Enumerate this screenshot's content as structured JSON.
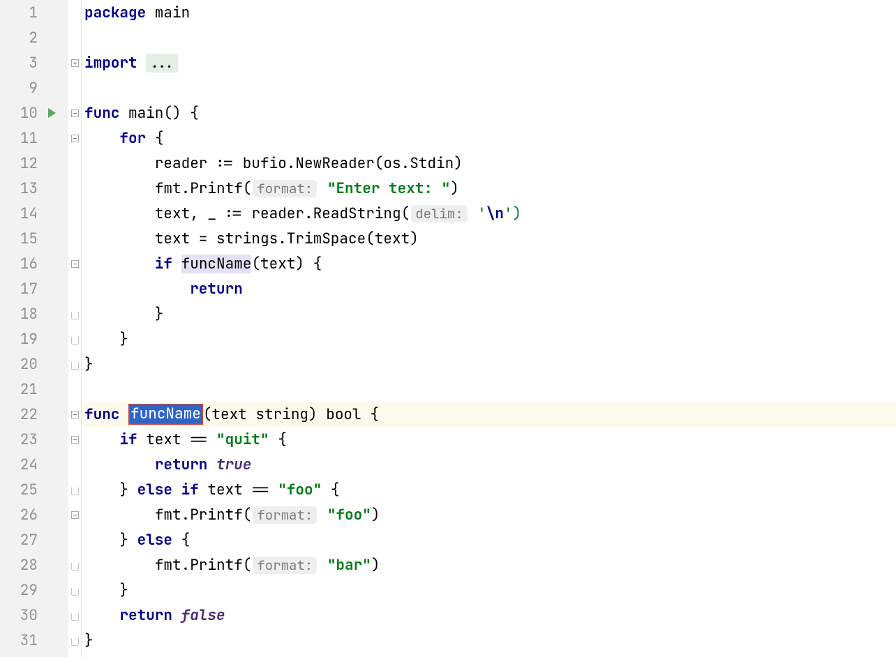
{
  "gutter_lines": [
    "1",
    "2",
    "3",
    "9",
    "10",
    "11",
    "12",
    "13",
    "14",
    "15",
    "16",
    "17",
    "18",
    "19",
    "20",
    "21",
    "22",
    "23",
    "24",
    "25",
    "26",
    "27",
    "28",
    "29",
    "30",
    "31"
  ],
  "run_icon_index": 4,
  "highlighted_index": 16,
  "fold_markers": {
    "2": "plus",
    "4": "minus",
    "5": "minus",
    "10": "minus",
    "12": "end",
    "13": "end",
    "14": "end",
    "16": "minus",
    "17": "minus",
    "19": "end",
    "20": "minus",
    "22": "end",
    "23": "end",
    "24": "end",
    "25": "end"
  },
  "tokens": {
    "package": "package",
    "main": "main",
    "import": "import",
    "ellipsis": "...",
    "func": "func",
    "open_paren_brace": "() {",
    "for": "for",
    "brace": "{",
    "reader": "reader",
    " := ": " := ",
    "bufio_new": "bufio.NewReader(os.Stdin)",
    "fmt_printf": "fmt.Printf(",
    "hint_format": "format:",
    "enter_text": "\"Enter text: \"",
    ")": ")",
    "text_assign": "text, _ := reader.ReadString(",
    "hint_delim": "delim:",
    "sq": "'",
    "esc_n": "\\n",
    "sq_close": "')",
    "trim": "text = strings.TrimSpace(text)",
    "if": "if",
    "funcName": "funcName",
    "call_text": "(text) {",
    "return": "return",
    "cb": "}",
    "funcName_sel": "funcName",
    "sig_rest": "(text string) bool {",
    "eq_quit": "text == ",
    "quit": "\"quit\"",
    "sp_brace": " {",
    "return_sp": "return ",
    "true": "true",
    "else_if": " else if ",
    "eq": "text == ",
    "foo": "\"foo\"",
    "else": " else ",
    "bar": "\"bar\"",
    "false": "false"
  }
}
